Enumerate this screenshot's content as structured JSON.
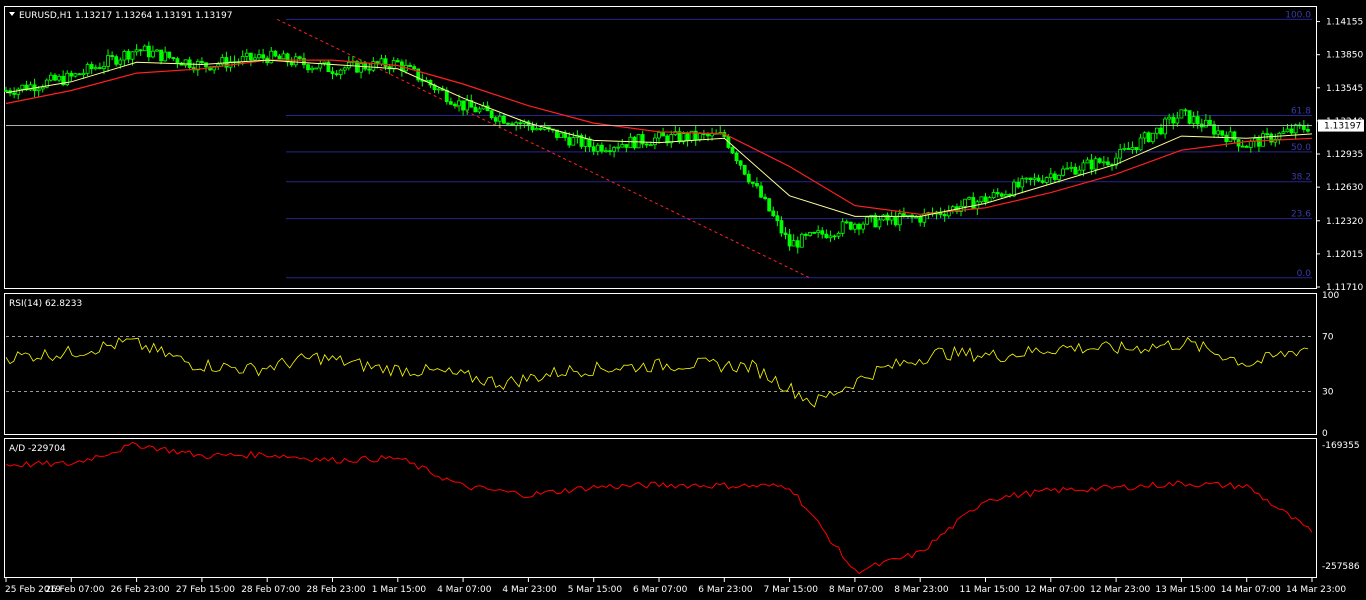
{
  "colors": {
    "background": "#000000",
    "frame": "#ffffff",
    "candle": "#00ff00",
    "ma_fast": "#ffff99",
    "ma_slow": "#ff2020",
    "fib": "#25258f",
    "fib_text": "#3a3aa8",
    "rsi": "#ffff00",
    "ad": "#ff0000",
    "trend_line": "#ff2020"
  },
  "main_panel": {
    "title_icon": "triangle-down-icon",
    "title": "EURUSD,H1  1.13217 1.13264 1.13191 1.13197",
    "price_ticks": [
      "1.14155",
      "1.13850",
      "1.13545",
      "1.13240",
      "1.12935",
      "1.12630",
      "1.12320",
      "1.12015",
      "1.11710"
    ],
    "current_price": "1.13197",
    "fib_levels": [
      {
        "label": "100.0",
        "price": 1.14175
      },
      {
        "label": "61.8",
        "price": 1.1329
      },
      {
        "label": "50.0",
        "price": 1.12955
      },
      {
        "label": "38.2",
        "price": 1.1268
      },
      {
        "label": "23.6",
        "price": 1.1234
      },
      {
        "label": "0.0",
        "price": 1.11795
      }
    ]
  },
  "rsi_panel": {
    "title": "RSI(14) 62.8233",
    "ticks": [
      "100",
      "70",
      "30",
      "0"
    ],
    "levels": [
      70,
      30
    ]
  },
  "ad_panel": {
    "title": "A/D -229704",
    "ticks": [
      "-169355",
      "-257586"
    ]
  },
  "time_axis": [
    "25 Feb 2019",
    "26 Feb 07:00",
    "26 Feb 23:00",
    "27 Feb 15:00",
    "28 Feb 07:00",
    "28 Feb 23:00",
    "1 Mar 15:00",
    "4 Mar 07:00",
    "4 Mar 23:00",
    "5 Mar 15:00",
    "6 Mar 07:00",
    "6 Mar 23:00",
    "7 Mar 15:00",
    "8 Mar 07:00",
    "8 Mar 23:00",
    "11 Mar 15:00",
    "12 Mar 07:00",
    "12 Mar 23:00",
    "13 Mar 15:00",
    "14 Mar 07:00",
    "14 Mar 23:00"
  ],
  "chart_data": [
    {
      "type": "line",
      "title": "EURUSD,H1",
      "series_kind": "candlestick_close",
      "ylim": [
        1.1171,
        1.1428
      ],
      "x": [
        "25 Feb 2019",
        "26 Feb 07:00",
        "26 Feb 23:00",
        "27 Feb 15:00",
        "28 Feb 07:00",
        "28 Feb 23:00",
        "1 Mar 15:00",
        "4 Mar 07:00",
        "4 Mar 23:00",
        "5 Mar 15:00",
        "6 Mar 07:00",
        "6 Mar 23:00",
        "7 Mar 15:00",
        "8 Mar 07:00",
        "8 Mar 23:00",
        "11 Mar 15:00",
        "12 Mar 07:00",
        "12 Mar 23:00",
        "13 Mar 15:00",
        "14 Mar 07:00",
        "14 Mar 23:00"
      ],
      "close": [
        1.1352,
        1.1364,
        1.139,
        1.1375,
        1.1383,
        1.1372,
        1.1377,
        1.1338,
        1.132,
        1.13,
        1.1308,
        1.131,
        1.121,
        1.123,
        1.1235,
        1.1252,
        1.1275,
        1.129,
        1.133,
        1.1302,
        1.132
      ],
      "ma_fast": [
        1.135,
        1.136,
        1.1378,
        1.1376,
        1.138,
        1.1376,
        1.1372,
        1.1345,
        1.1322,
        1.1306,
        1.1304,
        1.1308,
        1.1255,
        1.1236,
        1.1236,
        1.1248,
        1.1266,
        1.1284,
        1.131,
        1.1308,
        1.1312
      ],
      "ma_slow": [
        1.134,
        1.1352,
        1.1368,
        1.1372,
        1.138,
        1.138,
        1.1375,
        1.1358,
        1.1338,
        1.1322,
        1.1314,
        1.1312,
        1.1282,
        1.1246,
        1.1238,
        1.1244,
        1.1258,
        1.1275,
        1.1297,
        1.1305,
        1.1308
      ]
    },
    {
      "type": "line",
      "title": "RSI(14) 62.8233",
      "ylim": [
        0,
        100
      ],
      "x": [
        "25 Feb 2019",
        "26 Feb 07:00",
        "26 Feb 23:00",
        "27 Feb 15:00",
        "28 Feb 07:00",
        "28 Feb 23:00",
        "1 Mar 15:00",
        "4 Mar 07:00",
        "4 Mar 23:00",
        "5 Mar 15:00",
        "6 Mar 07:00",
        "6 Mar 23:00",
        "7 Mar 15:00",
        "8 Mar 07:00",
        "8 Mar 23:00",
        "11 Mar 15:00",
        "12 Mar 07:00",
        "12 Mar 23:00",
        "13 Mar 15:00",
        "14 Mar 07:00",
        "14 Mar 23:00"
      ],
      "values": [
        55,
        58,
        66,
        50,
        46,
        55,
        47,
        44,
        36,
        45,
        48,
        50,
        48,
        22,
        45,
        58,
        56,
        62,
        61,
        65,
        50,
        63
      ]
    },
    {
      "type": "line",
      "title": "A/D -229704",
      "ylim": [
        -260000,
        -166000
      ],
      "x": [
        "25 Feb 2019",
        "26 Feb 07:00",
        "26 Feb 23:00",
        "27 Feb 15:00",
        "28 Feb 07:00",
        "28 Feb 23:00",
        "1 Mar 15:00",
        "4 Mar 07:00",
        "4 Mar 23:00",
        "5 Mar 15:00",
        "6 Mar 07:00",
        "6 Mar 23:00",
        "7 Mar 15:00",
        "8 Mar 07:00",
        "8 Mar 23:00",
        "11 Mar 15:00",
        "12 Mar 07:00",
        "12 Mar 23:00",
        "13 Mar 15:00",
        "14 Mar 07:00",
        "14 Mar 23:00"
      ],
      "values": [
        -183000,
        -182500,
        -169000,
        -177000,
        -176000,
        -180000,
        -178500,
        -198000,
        -204000,
        -198500,
        -197000,
        -197500,
        -198000,
        -257000,
        -244000,
        -207000,
        -201000,
        -199000,
        -196000,
        -198000,
        -229704
      ]
    }
  ]
}
